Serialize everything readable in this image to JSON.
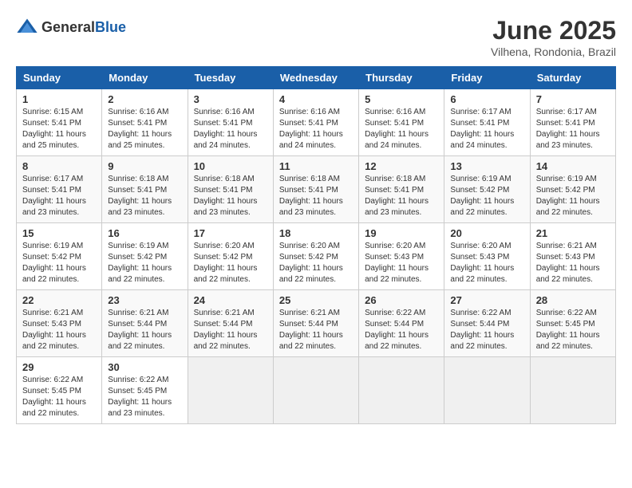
{
  "logo": {
    "general": "General",
    "blue": "Blue"
  },
  "title": "June 2025",
  "subtitle": "Vilhena, Rondonia, Brazil",
  "headers": [
    "Sunday",
    "Monday",
    "Tuesday",
    "Wednesday",
    "Thursday",
    "Friday",
    "Saturday"
  ],
  "weeks": [
    [
      {
        "day": "1",
        "sunrise": "6:15 AM",
        "sunset": "5:41 PM",
        "daylight": "11 hours and 25 minutes."
      },
      {
        "day": "2",
        "sunrise": "6:16 AM",
        "sunset": "5:41 PM",
        "daylight": "11 hours and 25 minutes."
      },
      {
        "day": "3",
        "sunrise": "6:16 AM",
        "sunset": "5:41 PM",
        "daylight": "11 hours and 24 minutes."
      },
      {
        "day": "4",
        "sunrise": "6:16 AM",
        "sunset": "5:41 PM",
        "daylight": "11 hours and 24 minutes."
      },
      {
        "day": "5",
        "sunrise": "6:16 AM",
        "sunset": "5:41 PM",
        "daylight": "11 hours and 24 minutes."
      },
      {
        "day": "6",
        "sunrise": "6:17 AM",
        "sunset": "5:41 PM",
        "daylight": "11 hours and 24 minutes."
      },
      {
        "day": "7",
        "sunrise": "6:17 AM",
        "sunset": "5:41 PM",
        "daylight": "11 hours and 23 minutes."
      }
    ],
    [
      {
        "day": "8",
        "sunrise": "6:17 AM",
        "sunset": "5:41 PM",
        "daylight": "11 hours and 23 minutes."
      },
      {
        "day": "9",
        "sunrise": "6:18 AM",
        "sunset": "5:41 PM",
        "daylight": "11 hours and 23 minutes."
      },
      {
        "day": "10",
        "sunrise": "6:18 AM",
        "sunset": "5:41 PM",
        "daylight": "11 hours and 23 minutes."
      },
      {
        "day": "11",
        "sunrise": "6:18 AM",
        "sunset": "5:41 PM",
        "daylight": "11 hours and 23 minutes."
      },
      {
        "day": "12",
        "sunrise": "6:18 AM",
        "sunset": "5:41 PM",
        "daylight": "11 hours and 23 minutes."
      },
      {
        "day": "13",
        "sunrise": "6:19 AM",
        "sunset": "5:42 PM",
        "daylight": "11 hours and 22 minutes."
      },
      {
        "day": "14",
        "sunrise": "6:19 AM",
        "sunset": "5:42 PM",
        "daylight": "11 hours and 22 minutes."
      }
    ],
    [
      {
        "day": "15",
        "sunrise": "6:19 AM",
        "sunset": "5:42 PM",
        "daylight": "11 hours and 22 minutes."
      },
      {
        "day": "16",
        "sunrise": "6:19 AM",
        "sunset": "5:42 PM",
        "daylight": "11 hours and 22 minutes."
      },
      {
        "day": "17",
        "sunrise": "6:20 AM",
        "sunset": "5:42 PM",
        "daylight": "11 hours and 22 minutes."
      },
      {
        "day": "18",
        "sunrise": "6:20 AM",
        "sunset": "5:42 PM",
        "daylight": "11 hours and 22 minutes."
      },
      {
        "day": "19",
        "sunrise": "6:20 AM",
        "sunset": "5:43 PM",
        "daylight": "11 hours and 22 minutes."
      },
      {
        "day": "20",
        "sunrise": "6:20 AM",
        "sunset": "5:43 PM",
        "daylight": "11 hours and 22 minutes."
      },
      {
        "day": "21",
        "sunrise": "6:21 AM",
        "sunset": "5:43 PM",
        "daylight": "11 hours and 22 minutes."
      }
    ],
    [
      {
        "day": "22",
        "sunrise": "6:21 AM",
        "sunset": "5:43 PM",
        "daylight": "11 hours and 22 minutes."
      },
      {
        "day": "23",
        "sunrise": "6:21 AM",
        "sunset": "5:44 PM",
        "daylight": "11 hours and 22 minutes."
      },
      {
        "day": "24",
        "sunrise": "6:21 AM",
        "sunset": "5:44 PM",
        "daylight": "11 hours and 22 minutes."
      },
      {
        "day": "25",
        "sunrise": "6:21 AM",
        "sunset": "5:44 PM",
        "daylight": "11 hours and 22 minutes."
      },
      {
        "day": "26",
        "sunrise": "6:22 AM",
        "sunset": "5:44 PM",
        "daylight": "11 hours and 22 minutes."
      },
      {
        "day": "27",
        "sunrise": "6:22 AM",
        "sunset": "5:44 PM",
        "daylight": "11 hours and 22 minutes."
      },
      {
        "day": "28",
        "sunrise": "6:22 AM",
        "sunset": "5:45 PM",
        "daylight": "11 hours and 22 minutes."
      }
    ],
    [
      {
        "day": "29",
        "sunrise": "6:22 AM",
        "sunset": "5:45 PM",
        "daylight": "11 hours and 22 minutes."
      },
      {
        "day": "30",
        "sunrise": "6:22 AM",
        "sunset": "5:45 PM",
        "daylight": "11 hours and 23 minutes."
      },
      null,
      null,
      null,
      null,
      null
    ]
  ]
}
